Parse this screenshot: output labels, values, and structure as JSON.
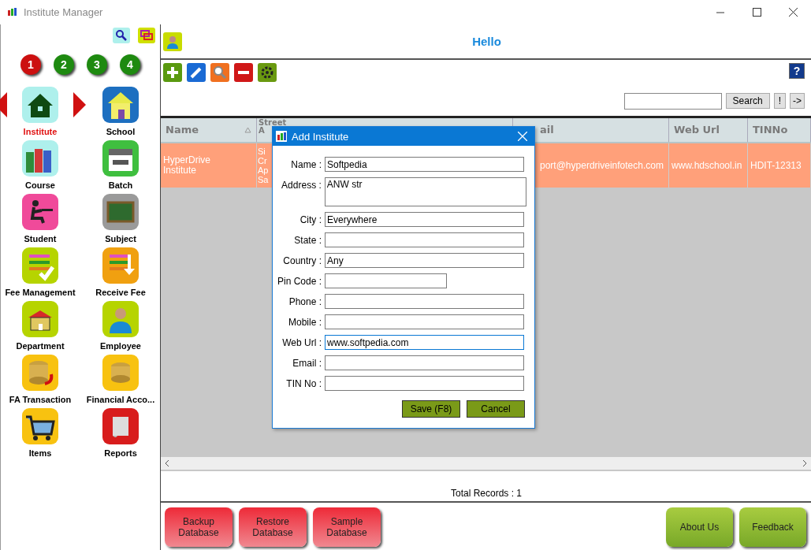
{
  "window": {
    "title": "Institute Manager"
  },
  "sidebar": {
    "pages": [
      {
        "label": "1",
        "selected": true
      },
      {
        "label": "2",
        "selected": false
      },
      {
        "label": "3",
        "selected": false
      },
      {
        "label": "4",
        "selected": false
      }
    ],
    "items": [
      {
        "label": "Institute",
        "selected": true
      },
      {
        "label": "School",
        "selected": false
      },
      {
        "label": "Course",
        "selected": false
      },
      {
        "label": "Batch",
        "selected": false
      },
      {
        "label": "Student",
        "selected": false
      },
      {
        "label": "Subject",
        "selected": false
      },
      {
        "label": "Fee Management",
        "selected": false
      },
      {
        "label": "Receive Fee",
        "selected": false
      },
      {
        "label": "Department",
        "selected": false
      },
      {
        "label": "Employee",
        "selected": false
      },
      {
        "label": "FA Transaction",
        "selected": false
      },
      {
        "label": "Financial Acco...",
        "selected": false
      },
      {
        "label": "Items",
        "selected": false
      },
      {
        "label": "Reports",
        "selected": false
      }
    ]
  },
  "header": {
    "greeting": "Hello"
  },
  "toolbar": {
    "help": "?",
    "search_button": "Search",
    "bang_button": "!",
    "next_button": "->"
  },
  "table": {
    "columns": [
      {
        "label": "Name",
        "sorted": true
      },
      {
        "label": "Street\nA",
        "sorted": false
      },
      {
        "label": "ail",
        "sorted": false
      },
      {
        "label": "Web Url",
        "sorted": false
      },
      {
        "label": "TINNo",
        "sorted": false
      }
    ],
    "rows": [
      {
        "selected": true,
        "cells": [
          "HyperDrive\nInstitute",
          "Si\nCr\nAp\nSa",
          "port@hyperdriveinfotech.com",
          "www.hdschool.in",
          "HDIT-12313"
        ]
      }
    ]
  },
  "total_records": "Total Records : 1",
  "bottom_buttons": [
    {
      "label": "Backup\nDatabase",
      "kind": "danger"
    },
    {
      "label": "Restore\nDatabase",
      "kind": "danger"
    },
    {
      "label": "Sample\nDatabase",
      "kind": "danger"
    },
    {
      "label": "About Us",
      "kind": "info"
    },
    {
      "label": "Feedback",
      "kind": "info"
    }
  ],
  "dialog": {
    "title": "Add Institute",
    "fields": [
      {
        "label": "Name :",
        "value": "Softpedia",
        "kind": "text"
      },
      {
        "label": "Address :",
        "value": "ANW str",
        "kind": "multiline"
      },
      {
        "label": "City :",
        "value": "Everywhere",
        "kind": "text"
      },
      {
        "label": "State :",
        "kind": "text"
      },
      {
        "label": "Country :",
        "value": "Any",
        "kind": "text"
      },
      {
        "label": "Pin Code :",
        "kind": "short"
      },
      {
        "label": "Phone :",
        "kind": "text"
      },
      {
        "label": "Mobile :",
        "kind": "text"
      },
      {
        "label": "Web Url :",
        "value": "www.softpedia.com",
        "kind": "text",
        "focused": true
      },
      {
        "label": "Email :",
        "kind": "text"
      },
      {
        "label": "TIN No :",
        "kind": "text"
      }
    ],
    "buttons": [
      "Save (F8)",
      "Cancel"
    ]
  }
}
